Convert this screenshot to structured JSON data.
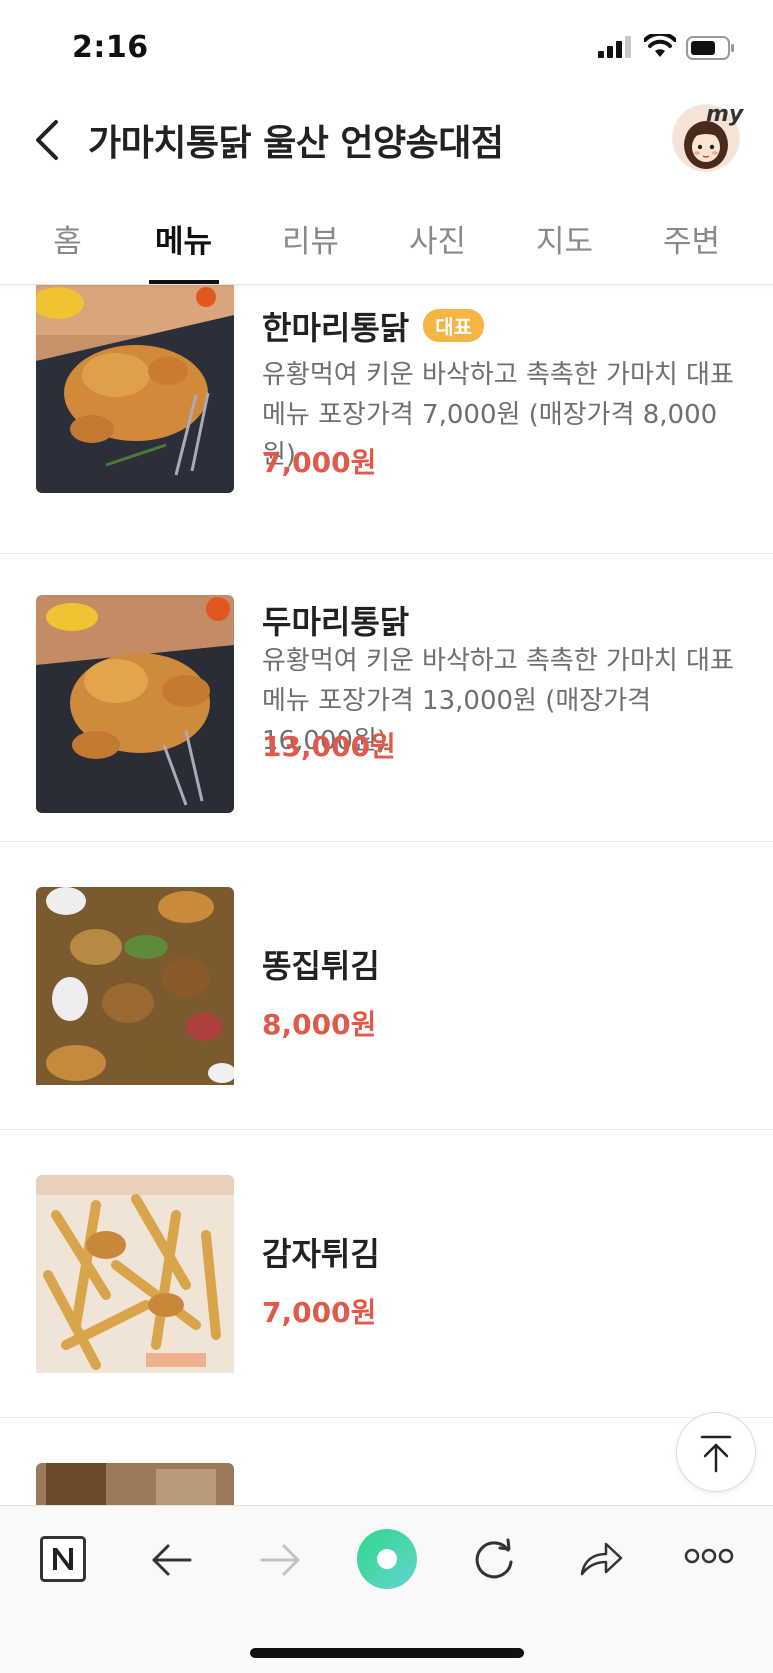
{
  "status_bar": {
    "time": "2:16"
  },
  "header": {
    "title": "가마치통닭 울산 언양송대점",
    "avatar_badge": "my"
  },
  "tabs": [
    {
      "label": "홈",
      "active": false
    },
    {
      "label": "메뉴",
      "active": true
    },
    {
      "label": "리뷰",
      "active": false
    },
    {
      "label": "사진",
      "active": false
    },
    {
      "label": "지도",
      "active": false
    },
    {
      "label": "주변",
      "active": false
    }
  ],
  "menu": {
    "items": [
      {
        "name": "한마리통닭",
        "badge": "대표",
        "description": "유황먹여 키운 바삭하고 촉촉한 가마치 대표메뉴 포장가격 7,000원 (매장가격 8,000원)",
        "price": "7,000원"
      },
      {
        "name": "두마리통닭",
        "description": "유황먹여 키운 바삭하고 촉촉한 가마치 대표메뉴 포장가격 13,000원 (매장가격 16,000원)",
        "price": "13,000원"
      },
      {
        "name": "똥집튀김",
        "price": "8,000원"
      },
      {
        "name": "감자튀김",
        "price": "7,000원"
      }
    ]
  },
  "icons": {
    "back": "back-chevron-icon",
    "scroll_top": "arrow-up-icon",
    "bottom_bar": [
      "naver-n-icon",
      "back-arrow-icon",
      "forward-arrow-icon",
      "green-dot-icon",
      "refresh-icon",
      "share-icon",
      "more-icon"
    ]
  },
  "colors": {
    "price": "#e05a4a",
    "badge": "#f5b544",
    "green_button": "#3ecf8e"
  }
}
